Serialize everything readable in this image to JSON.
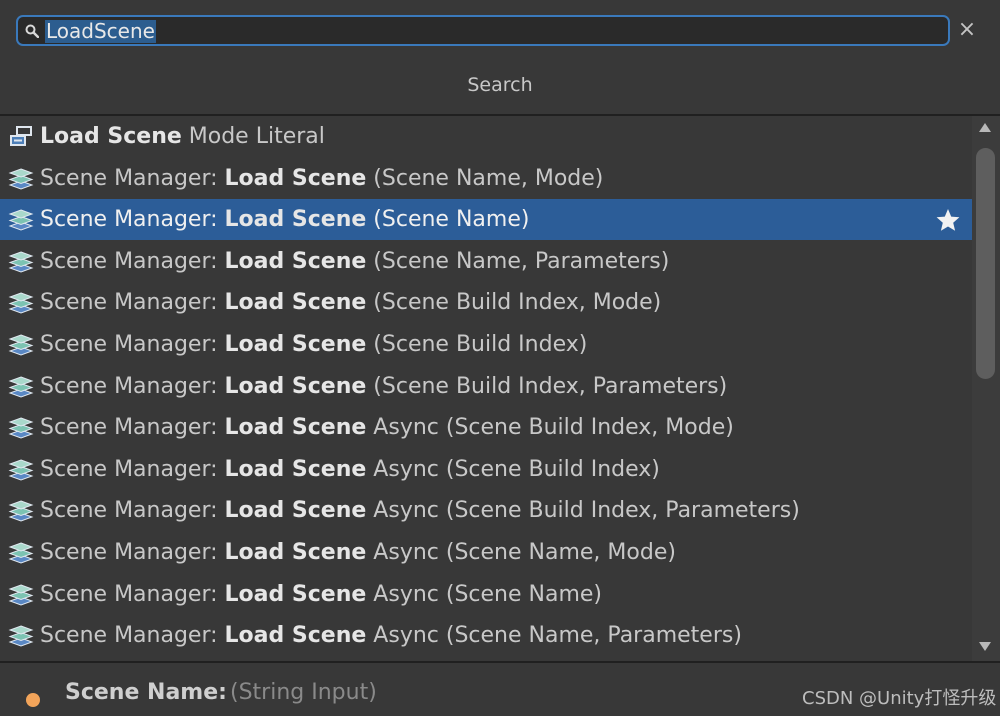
{
  "search": {
    "value": "LoadScene",
    "clear_glyph": "×"
  },
  "header": {
    "title": "Search"
  },
  "results": [
    {
      "bold": "Load Scene",
      "after": " Mode Literal",
      "icon": "enum-literal-icon"
    },
    {
      "prefix": "Scene Manager: ",
      "bold": "Load Scene",
      "after": " (Scene Name, Mode)",
      "icon": "scene-layers-icon"
    },
    {
      "prefix": "Scene Manager: ",
      "bold": "Load Scene",
      "after": " (Scene Name)",
      "icon": "scene-layers-icon",
      "selected": true,
      "favorite": true
    },
    {
      "prefix": "Scene Manager: ",
      "bold": "Load Scene",
      "after": " (Scene Name, Parameters)",
      "icon": "scene-layers-icon"
    },
    {
      "prefix": "Scene Manager: ",
      "bold": "Load Scene",
      "after": " (Scene Build Index, Mode)",
      "icon": "scene-layers-icon"
    },
    {
      "prefix": "Scene Manager: ",
      "bold": "Load Scene",
      "after": " (Scene Build Index)",
      "icon": "scene-layers-icon"
    },
    {
      "prefix": "Scene Manager: ",
      "bold": "Load Scene",
      "after": " (Scene Build Index, Parameters)",
      "icon": "scene-layers-icon"
    },
    {
      "prefix": "Scene Manager: ",
      "bold": "Load Scene",
      "after": " Async (Scene Build Index, Mode)",
      "icon": "scene-layers-icon"
    },
    {
      "prefix": "Scene Manager: ",
      "bold": "Load Scene",
      "after": " Async (Scene Build Index)",
      "icon": "scene-layers-icon"
    },
    {
      "prefix": "Scene Manager: ",
      "bold": "Load Scene",
      "after": " Async (Scene Build Index, Parameters)",
      "icon": "scene-layers-icon"
    },
    {
      "prefix": "Scene Manager: ",
      "bold": "Load Scene",
      "after": " Async (Scene Name, Mode)",
      "icon": "scene-layers-icon"
    },
    {
      "prefix": "Scene Manager: ",
      "bold": "Load Scene",
      "after": " Async (Scene Name)",
      "icon": "scene-layers-icon"
    },
    {
      "prefix": "Scene Manager: ",
      "bold": "Load Scene",
      "after": " Async (Scene Name, Parameters)",
      "icon": "scene-layers-icon"
    }
  ],
  "footer": {
    "port_label": "Scene Name:",
    "port_type": "(String Input)",
    "port_color": "#f2a45a"
  },
  "watermark": "CSDN @Unity打怪升级",
  "colors": {
    "accent": "#3a79bb",
    "selection": "#2c5d98",
    "background": "#383838"
  }
}
